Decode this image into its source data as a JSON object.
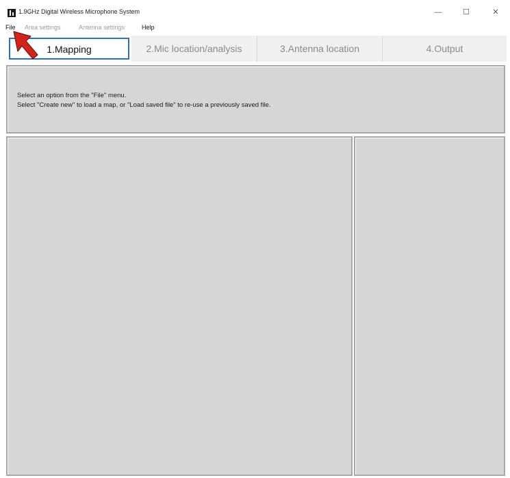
{
  "window": {
    "title": "1.9GHz Digital Wireless Microphone System",
    "controls": {
      "minimize": "—",
      "maximize": "☐",
      "close": "✕"
    },
    "icon": "app-logo-icon"
  },
  "menu": {
    "file": "File",
    "area_settings": "Area settings",
    "antenna_settings": "Antenna settings",
    "help": "Help"
  },
  "tabs": [
    {
      "label": "1.Mapping",
      "active": true
    },
    {
      "label": "2.Mic location/analysis",
      "active": false
    },
    {
      "label": "3.Antenna location",
      "active": false
    },
    {
      "label": "4.Output",
      "active": false
    }
  ],
  "info": {
    "line1": "Select an option from the \"File\" menu.",
    "line2": "Select \"Create new\" to load a map, or \"Load saved file\" to re-use a previously saved file."
  },
  "pointer": {
    "icon": "red-arrow-pointer-icon",
    "color": "#d0251c"
  },
  "colors": {
    "active_tab_border": "#2c6fc2",
    "panel_background": "#d6d6d6",
    "disabled_text": "#9a9a9a"
  }
}
